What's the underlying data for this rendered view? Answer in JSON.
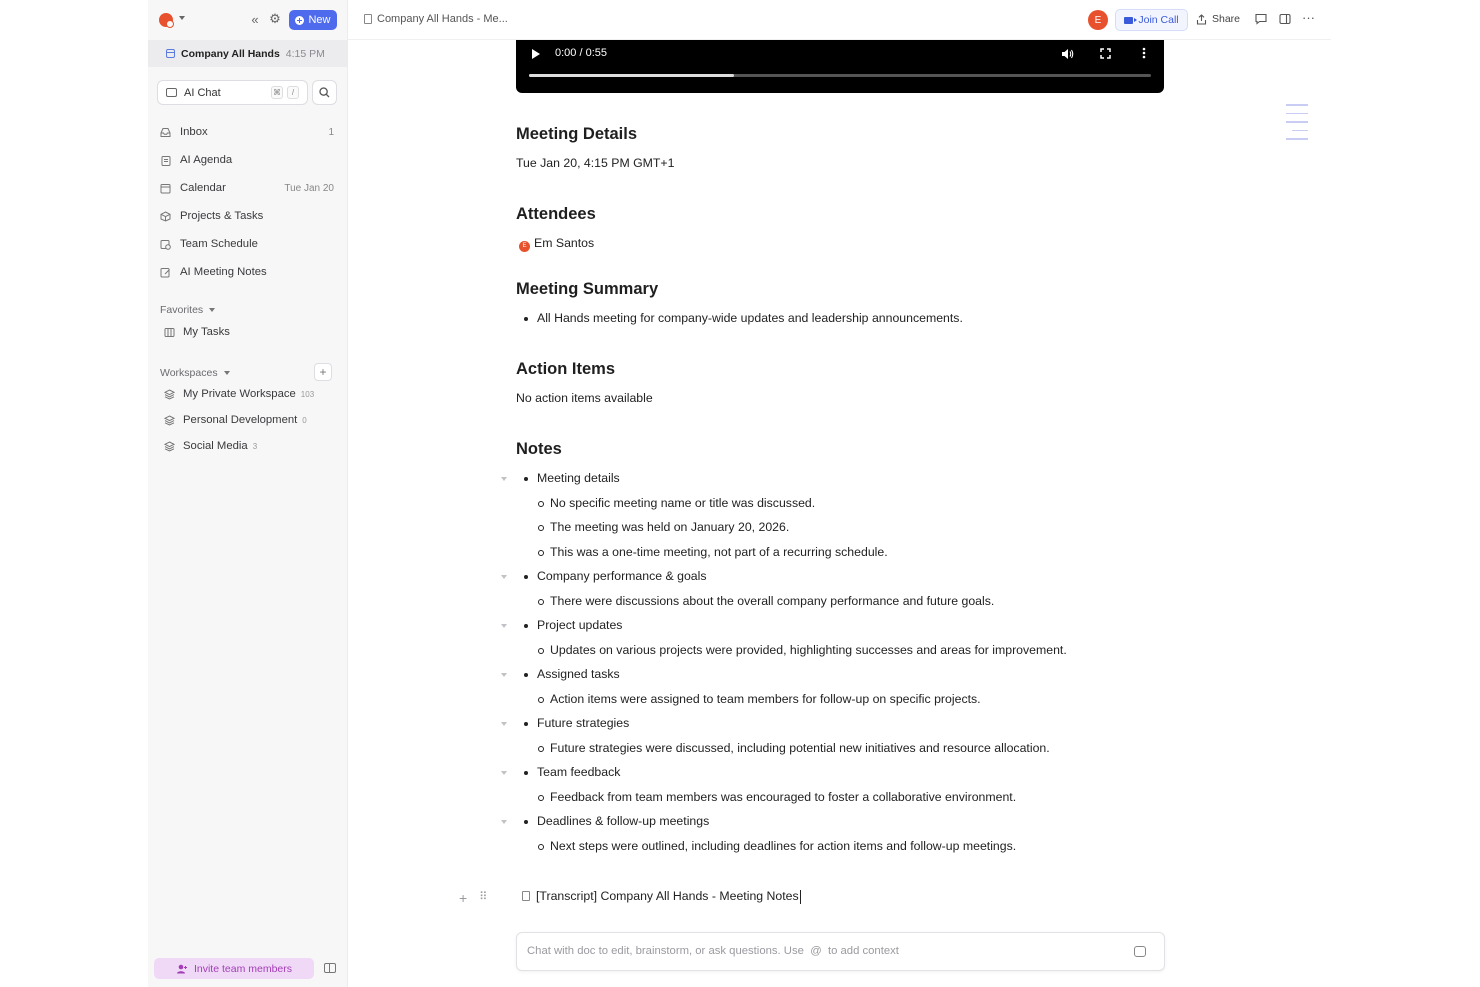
{
  "sidebar": {
    "new_label": "New",
    "current": {
      "name": "Company All Hands",
      "time": "4:15 PM"
    },
    "ai_chat": {
      "label": "AI Chat",
      "kbd1": "⌘",
      "kbd2": "/"
    },
    "nav": [
      {
        "label": "Inbox",
        "right": "1",
        "icon": "inbox-icon"
      },
      {
        "label": "AI Agenda",
        "right": "",
        "icon": "clipboard-icon"
      },
      {
        "label": "Calendar",
        "right": "Tue Jan 20",
        "icon": "calendar-icon"
      },
      {
        "label": "Projects & Tasks",
        "right": "",
        "icon": "cube-icon"
      },
      {
        "label": "Team Schedule",
        "right": "",
        "icon": "schedule-icon"
      },
      {
        "label": "AI Meeting Notes",
        "right": "",
        "icon": "notes-icon"
      }
    ],
    "favorites": {
      "label": "Favorites",
      "items": [
        {
          "label": "My Tasks",
          "icon": "board-icon"
        }
      ]
    },
    "workspaces": {
      "label": "Workspaces",
      "items": [
        {
          "label": "My Private Workspace",
          "count": "103"
        },
        {
          "label": "Personal Development",
          "count": "0"
        },
        {
          "label": "Social Media",
          "count": "3"
        }
      ]
    },
    "invite_label": "Invite team members"
  },
  "topbar": {
    "breadcrumb": "Company All Hands - Me...",
    "avatar_letter": "E",
    "join_call": "Join Call",
    "share": "Share"
  },
  "video": {
    "time": "0:00 / 0:55",
    "progress": 0.33
  },
  "doc": {
    "meeting_details_heading": "Meeting Details",
    "meeting_details_text": "Tue Jan 20, 4:15 PM GMT+1",
    "attendees_heading": "Attendees",
    "attendee_initial": "E",
    "attendee_name": "Em Santos",
    "summary_heading": "Meeting Summary",
    "summary_item": "All Hands meeting for company-wide updates and leadership announcements.",
    "action_heading": "Action Items",
    "action_text": "No action items available",
    "notes_heading": "Notes",
    "notes": [
      {
        "title": "Meeting details",
        "items": [
          "No specific meeting name or title was discussed.",
          "The meeting was held on January 20, 2026.",
          "This was a one-time meeting, not part of a recurring schedule."
        ]
      },
      {
        "title": "Company performance & goals",
        "items": [
          "There were discussions about the overall company performance and future goals."
        ]
      },
      {
        "title": "Project updates",
        "items": [
          "Updates on various projects were provided, highlighting successes and areas for improvement."
        ]
      },
      {
        "title": "Assigned tasks",
        "items": [
          "Action items were assigned to team members for follow-up on specific projects."
        ]
      },
      {
        "title": "Future strategies",
        "items": [
          "Future strategies were discussed, including potential new initiatives and resource allocation."
        ]
      },
      {
        "title": "Team feedback",
        "items": [
          "Feedback from team members was encouraged to foster a collaborative environment."
        ]
      },
      {
        "title": "Deadlines & follow-up meetings",
        "items": [
          "Next steps were outlined, including deadlines for action items and follow-up meetings."
        ]
      }
    ],
    "transcript_link": "[Transcript] Company All Hands - Meeting Notes",
    "chat_placeholder_a": "Chat with doc to edit, brainstorm, or ask questions. Use",
    "chat_placeholder_at": "@",
    "chat_placeholder_b": "to add context"
  }
}
